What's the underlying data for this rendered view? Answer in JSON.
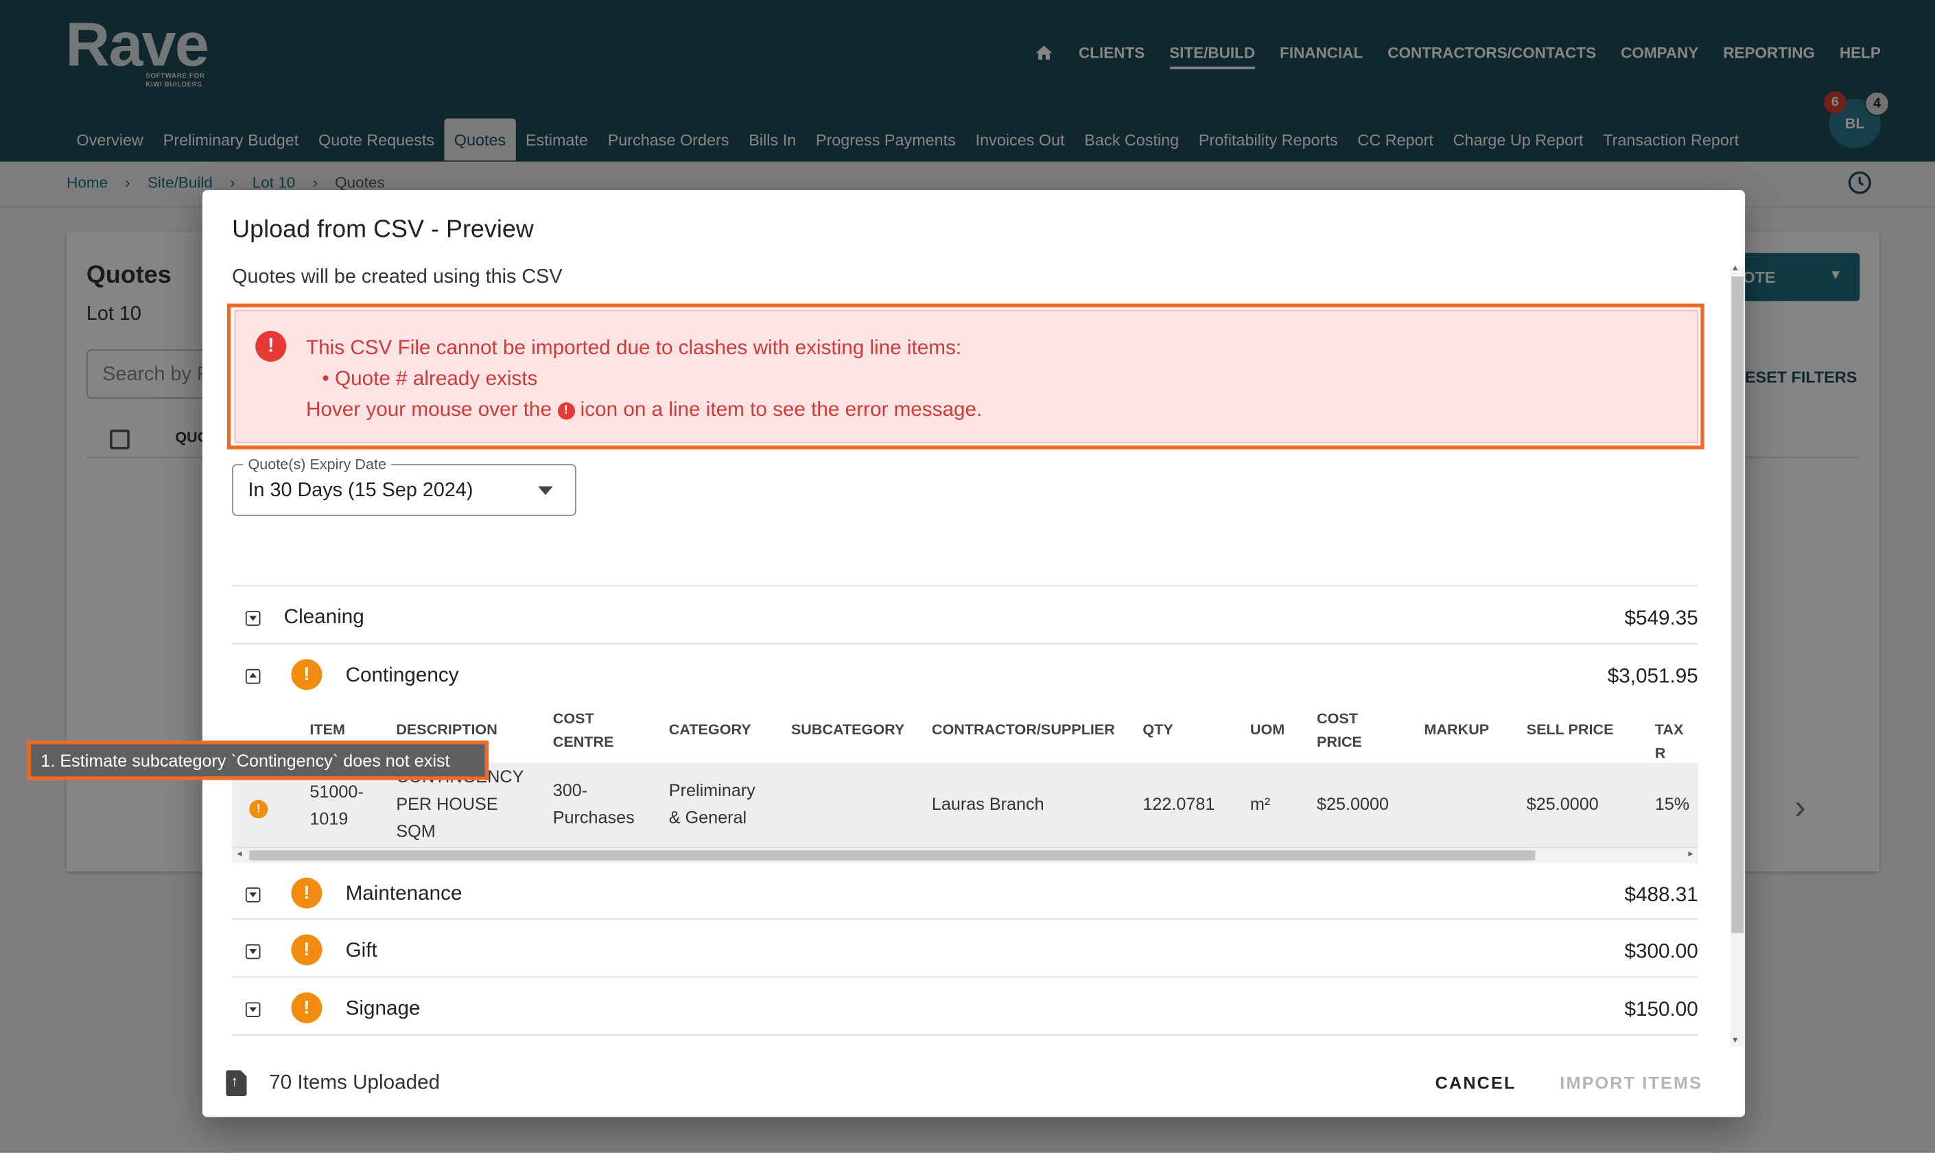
{
  "app": {
    "logo": "Rave",
    "logo_tagline_1": "SOFTWARE FOR",
    "logo_tagline_2": "KIWI BUILDERS"
  },
  "top_nav": {
    "items": [
      "CLIENTS",
      "SITE/BUILD",
      "FINANCIAL",
      "CONTRACTORS/CONTACTS",
      "COMPANY",
      "REPORTING",
      "HELP"
    ],
    "active": "SITE/BUILD"
  },
  "sub_nav": {
    "items": [
      "Overview",
      "Preliminary Budget",
      "Quote Requests",
      "Quotes",
      "Estimate",
      "Purchase Orders",
      "Bills In",
      "Progress Payments",
      "Invoices Out",
      "Back Costing",
      "Profitability Reports",
      "CC Report",
      "Charge Up Report",
      "Transaction Report"
    ],
    "active": "Quotes"
  },
  "user": {
    "initials": "BL",
    "badge_red": "6",
    "badge_grey": "4"
  },
  "breadcrumb": {
    "items": [
      "Home",
      "Site/Build",
      "Lot 10",
      "Quotes"
    ],
    "separator": "›"
  },
  "background_page": {
    "title": "Quotes",
    "subtitle": "Lot 10",
    "search_placeholder": "Search by F",
    "column_partial": "QUO",
    "quote_button_partial": "OTE",
    "reset_filters_partial": "ESET FILTERS"
  },
  "dialog": {
    "title": "Upload from CSV - Preview",
    "subtitle": "Quotes will be created using this CSV",
    "alert": {
      "line1": "This CSV File cannot be imported due to clashes with existing line items:",
      "bullet": "Quote # already exists",
      "line3_pre": "Hover your mouse over the",
      "line3_post": "icon on a line item to see the error message."
    },
    "expiry_select": {
      "label": "Quote(s) Expiry Date",
      "value": "In 30 Days (15 Sep 2024)"
    },
    "groups": [
      {
        "name": "Cleaning",
        "amount": "$549.35",
        "warning": false,
        "expanded": false
      },
      {
        "name": "Contingency",
        "amount": "$3,051.95",
        "warning": true,
        "expanded": true
      },
      {
        "name": "Maintenance",
        "amount": "$488.31",
        "warning": true,
        "expanded": false
      },
      {
        "name": "Gift",
        "amount": "$300.00",
        "warning": true,
        "expanded": false
      },
      {
        "name": "Signage",
        "amount": "$150.00",
        "warning": true,
        "expanded": false
      }
    ],
    "table": {
      "headers": {
        "item": "ITEM",
        "description": "DESCRIPTION",
        "cost_centre_1": "COST",
        "cost_centre_2": "CENTRE",
        "category": "CATEGORY",
        "subcategory": "SUBCATEGORY",
        "contractor": "CONTRACTOR/SUPPLIER",
        "qty": "QTY",
        "uom": "UOM",
        "cost_price_1": "COST",
        "cost_price_2": "PRICE",
        "markup": "MARKUP",
        "sell_price": "SELL PRICE",
        "tax": "TAX R"
      },
      "row": {
        "item_1": "51000-",
        "item_2": "1019",
        "desc_1": "CONTINGENCY",
        "desc_2": "PER HOUSE",
        "desc_3": "SQM",
        "cc_1": "300-",
        "cc_2": "Purchases",
        "cat_1": "Preliminary",
        "cat_2": "& General",
        "subcategory": "",
        "contractor": "Lauras Branch",
        "qty": "122.0781",
        "uom": "m²",
        "cost_price": "$25.0000",
        "markup": "",
        "sell_price": "$25.0000",
        "tax": "15%"
      }
    },
    "footer": {
      "count_text": "70 Items Uploaded",
      "cancel": "CANCEL",
      "import": "IMPORT ITEMS"
    }
  },
  "tooltip": {
    "text": "1. Estimate subcategory `Contingency` does not exist"
  },
  "colors": {
    "header_bg": "#1f4b58",
    "error_red": "#e53935",
    "warning_orange": "#f28c0f",
    "highlight_orange": "#f06a23"
  }
}
